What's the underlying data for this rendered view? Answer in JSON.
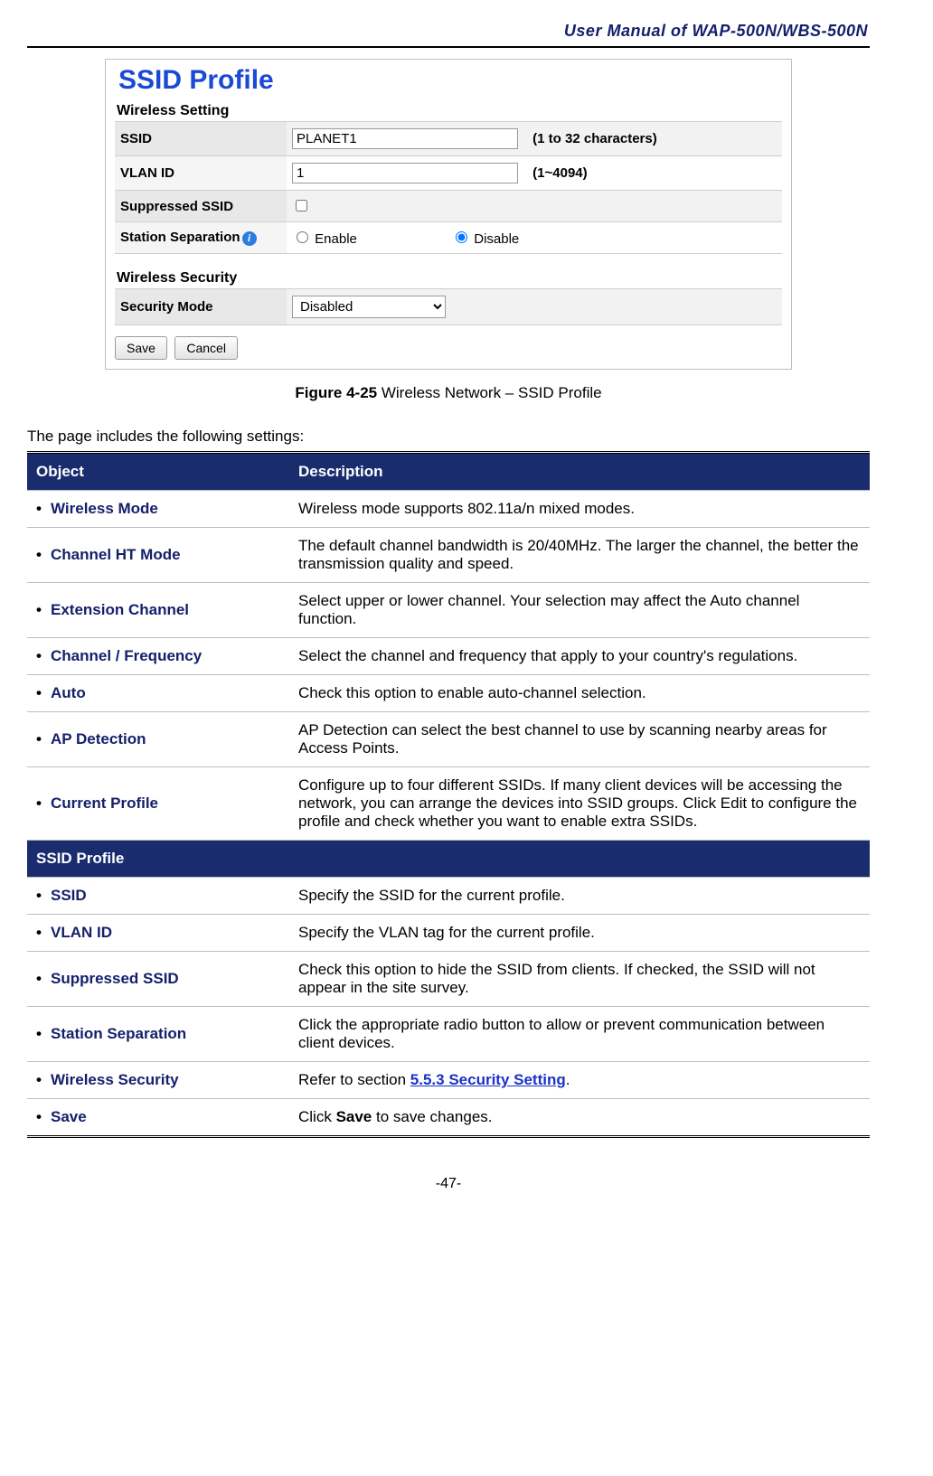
{
  "header": {
    "doc_title": "User Manual of WAP-500N/WBS-500N"
  },
  "screenshot": {
    "title": "SSID Profile",
    "wireless_setting_label": "Wireless Setting",
    "wireless_security_label": "Wireless Security",
    "rows": {
      "ssid": {
        "label": "SSID",
        "value": "PLANET1",
        "hint": "(1 to 32 characters)"
      },
      "vlan": {
        "label": "VLAN ID",
        "value": "1",
        "hint": "(1~4094)"
      },
      "suppressed": {
        "label": "Suppressed SSID",
        "checked": false
      },
      "station_sep": {
        "label": "Station Separation",
        "enable_label": "Enable",
        "disable_label": "Disable",
        "selected": "disable"
      },
      "security_mode": {
        "label": "Security Mode",
        "value": "Disabled"
      }
    },
    "buttons": {
      "save": "Save",
      "cancel": "Cancel"
    },
    "info_icon_glyph": "i"
  },
  "caption": {
    "figure_num": "Figure 4-25",
    "text": " Wireless Network – SSID Profile"
  },
  "intro": "The page includes the following settings:",
  "desc_table": {
    "headers": {
      "object": "Object",
      "description": "Description"
    },
    "section_group2": "SSID Profile",
    "rows": [
      {
        "object": "Wireless Mode",
        "description": "Wireless mode supports 802.11a/n mixed modes."
      },
      {
        "object": "Channel HT Mode",
        "description": "The default channel bandwidth is 20/40MHz. The larger the channel, the better the transmission quality and speed."
      },
      {
        "object": "Extension Channel",
        "description": "Select upper or lower channel. Your selection may affect the Auto channel function."
      },
      {
        "object": "Channel / Frequency",
        "description": "Select the channel and frequency that apply to your country's regulations."
      },
      {
        "object": "Auto",
        "description": "Check this option to enable auto-channel selection."
      },
      {
        "object": "AP Detection",
        "description": "AP Detection can select the best channel to use by scanning nearby areas for Access Points."
      },
      {
        "object": "Current Profile",
        "description": "Configure up to four different SSIDs. If many client devices will be accessing the network, you can arrange the devices into SSID groups. Click Edit to configure the profile and check whether you want to enable extra SSIDs."
      }
    ],
    "rows2": [
      {
        "object": "SSID",
        "description": "Specify the SSID for the current profile."
      },
      {
        "object": "VLAN ID",
        "description": "Specify the VLAN tag for the current profile."
      },
      {
        "object": "Suppressed SSID",
        "description": "Check this option to hide the SSID from clients. If checked, the SSID will not appear in the site survey."
      },
      {
        "object": "Station Separation",
        "description": "Click the appropriate radio button to allow or prevent communication between client devices."
      },
      {
        "object": "Wireless Security",
        "description_prefix": "Refer to section ",
        "link_text": "5.5.3 Security Setting",
        "description_suffix": "."
      },
      {
        "object": "Save",
        "description_prefix": "Click ",
        "strong": "Save",
        "description_suffix": " to save changes."
      }
    ]
  },
  "page_number": "-47-"
}
